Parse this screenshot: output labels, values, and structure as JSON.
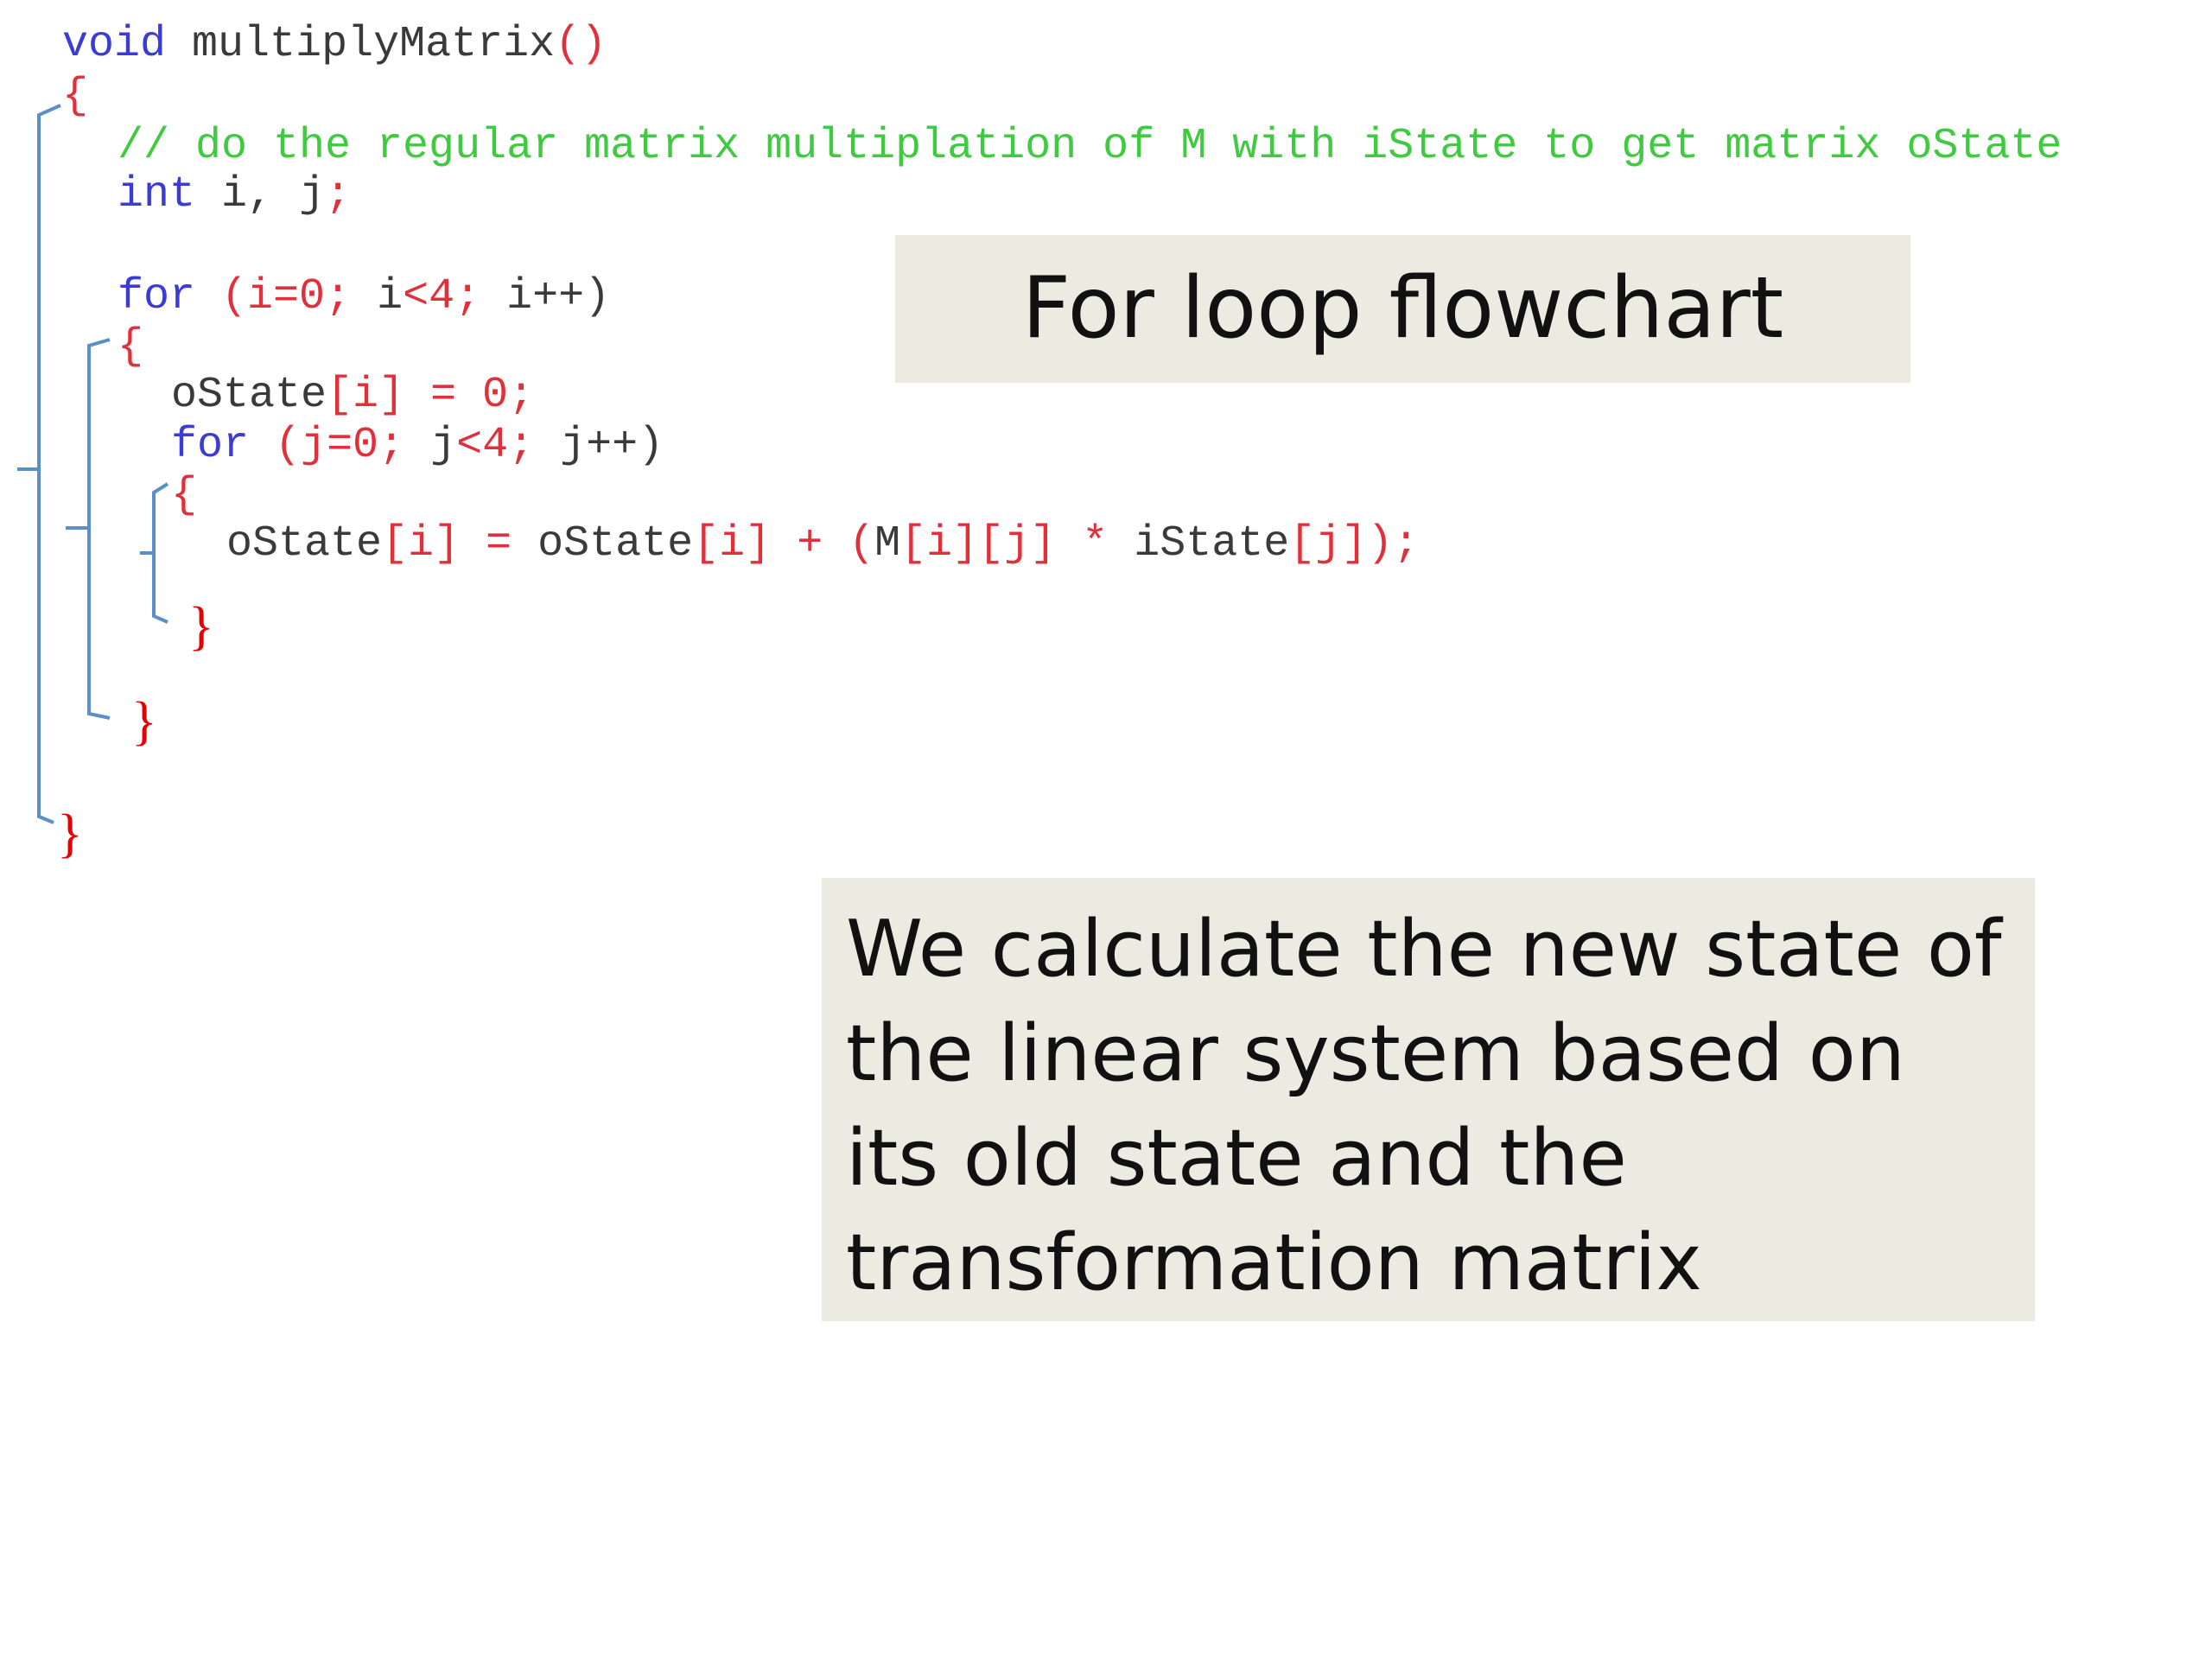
{
  "code": {
    "l1_kw": "void",
    "l1_name": "multiplyMatrix",
    "l1_parens": "()",
    "l2_brace": "{",
    "l3_comment": "// do the regular matrix multiplation of M with iState to get matrix oState",
    "l4_kw": "int",
    "l4_vars": "i,",
    "l4_j": "j",
    "l4_semi": ";",
    "l5_kw": "for",
    "l5_open": "(i=0;",
    "l5_i": "i",
    "l5_cond": "<4;",
    "l5_inc": "i++)",
    "l6_brace": "{",
    "l7_var": "oState",
    "l7_rest": "[i] = 0;",
    "l8_kw": "for",
    "l8_open": "(j=0;",
    "l8_j": "j",
    "l8_cond": "<4;",
    "l8_inc": "j++)",
    "l9_brace": "{",
    "l10_a": "oState",
    "l10_b": "[i] = ",
    "l10_c": "oState",
    "l10_d": "[i] + (",
    "l10_e": "M",
    "l10_f": "[i][j] * ",
    "l10_g": "iState",
    "l10_h": "[j]);",
    "l11_brace": "}",
    "l12_brace": "}",
    "l13_brace": "}"
  },
  "title_box": {
    "text": "For loop flowchart"
  },
  "description_box": {
    "text": "We calculate the new state of the linear system based on its old state and the transformation matrix"
  },
  "colors": {
    "keyword": "#3b3bd6",
    "identifier": "#3a3a3a",
    "punctuation": "#e0303a",
    "comment": "#3fca3f",
    "bracket_line": "#5b8fc9",
    "box_background": "#ecebe1"
  }
}
